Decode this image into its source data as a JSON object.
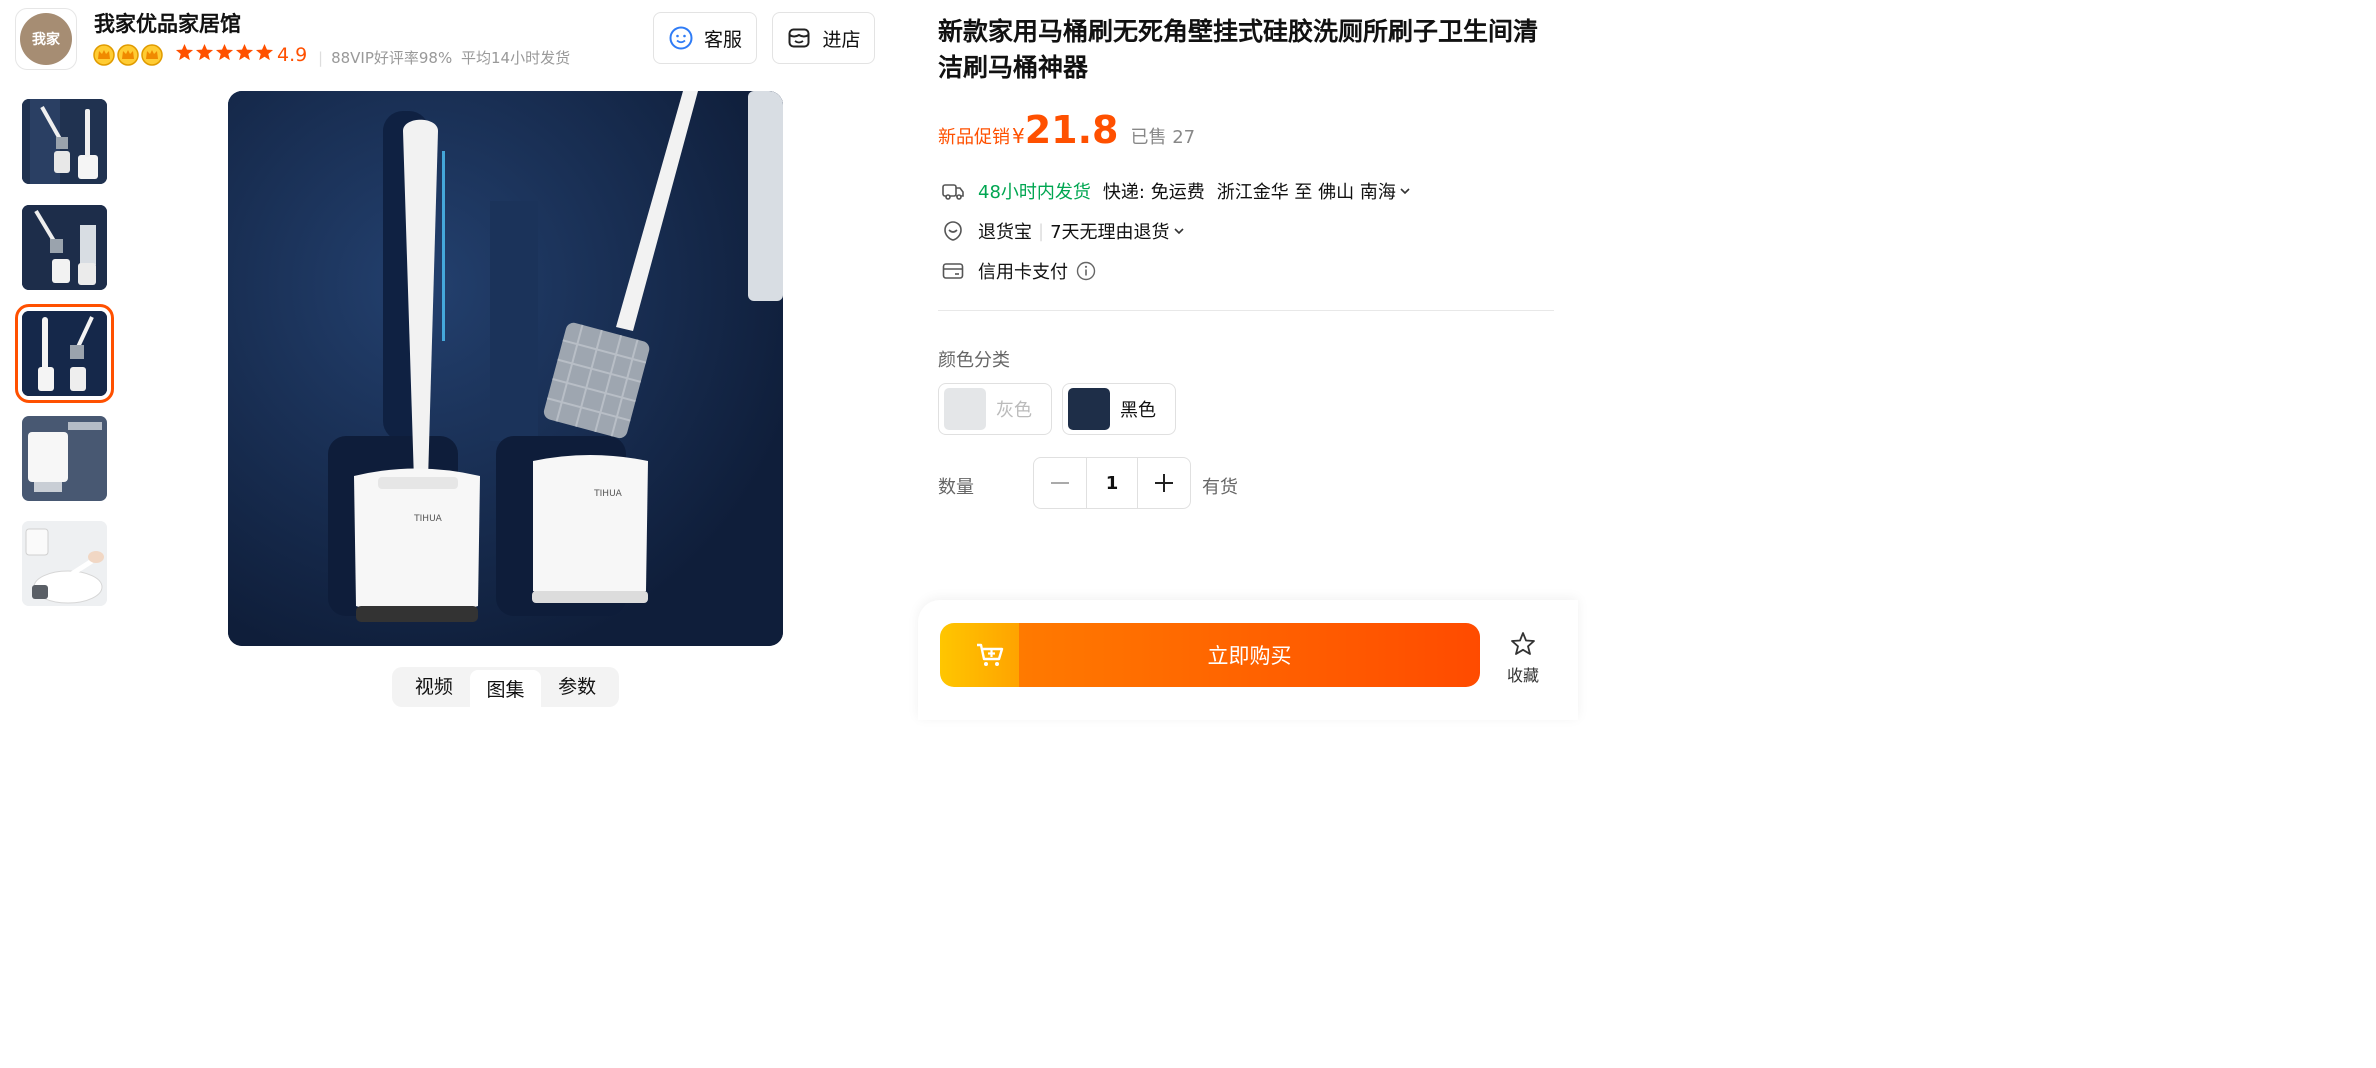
{
  "shop": {
    "logo_text": "我家",
    "name": "我家优品家居馆",
    "rating": "4.9",
    "vip_text": "88VIP好评率98%",
    "ship_time": "平均14小时发货"
  },
  "header_buttons": {
    "service": "客服",
    "store": "进店"
  },
  "media_tabs": [
    "视频",
    "图集",
    "参数"
  ],
  "product": {
    "title": "新款家用马桶刷无死角壁挂式硅胶洗厕所刷子卫生间清洁刷马桶神器",
    "promo_label": "新品促销",
    "currency": "¥",
    "price": "21.8",
    "sold": "已售 27",
    "image_brand": "TIHUA"
  },
  "shipping": {
    "badge": "48小时内发货",
    "courier": "快递: 免运费",
    "route": "浙江金华 至 佛山 南海"
  },
  "returns": {
    "label": "退货宝",
    "policy": "7天无理由退货"
  },
  "payment": {
    "label": "信用卡支付"
  },
  "sku": {
    "label": "颜色分类",
    "options": [
      "灰色",
      "黑色"
    ],
    "selected": "黑色",
    "disabled": [
      "灰色"
    ]
  },
  "quantity": {
    "label": "数量",
    "value": "1",
    "stock": "有货"
  },
  "buy": {
    "label": "立即购买",
    "favorite": "收藏"
  },
  "colors": {
    "accent": "#ff5000",
    "green": "#00a651"
  }
}
